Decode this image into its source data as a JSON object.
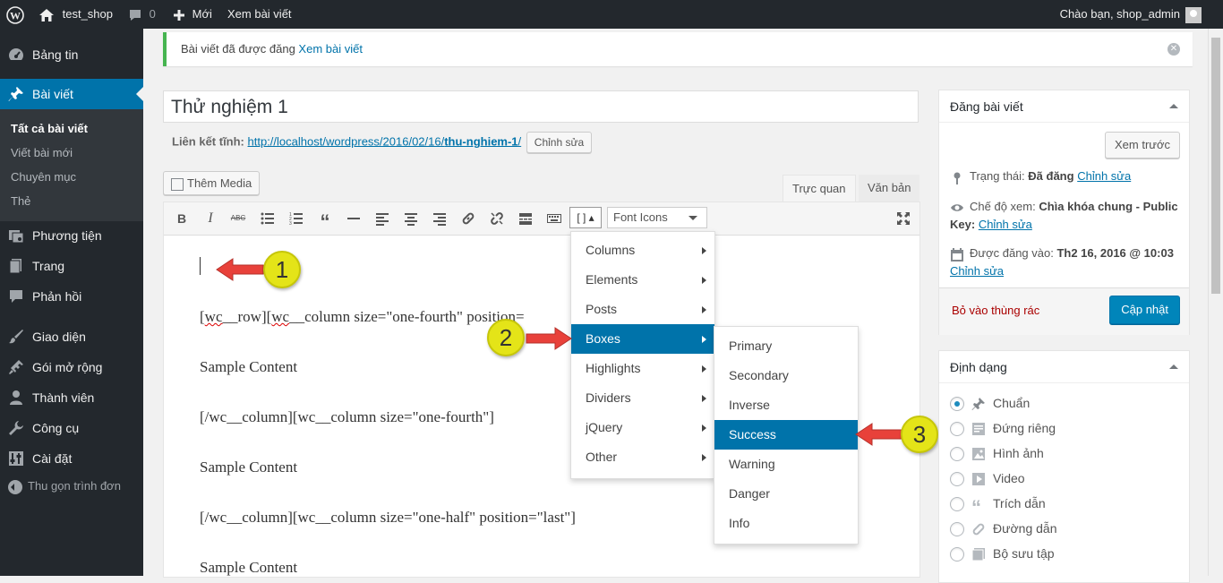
{
  "admin_bar": {
    "site_name": "test_shop",
    "comments_count": "0",
    "new_label": "Mới",
    "view_post_label": "Xem bài viết",
    "greeting": "Chào bạn, shop_admin"
  },
  "sidebar": {
    "items": [
      {
        "label": "Bảng tin",
        "icon": "dashboard-icon"
      },
      {
        "label": "Bài viết",
        "icon": "pin-icon"
      },
      {
        "label": "Phương tiện",
        "icon": "media-icon"
      },
      {
        "label": "Trang",
        "icon": "page-icon"
      },
      {
        "label": "Phản hồi",
        "icon": "comment-icon"
      },
      {
        "label": "Giao diện",
        "icon": "brush-icon"
      },
      {
        "label": "Gói mở rộng",
        "icon": "plugin-icon"
      },
      {
        "label": "Thành viên",
        "icon": "user-icon"
      },
      {
        "label": "Công cụ",
        "icon": "wrench-icon"
      },
      {
        "label": "Cài đặt",
        "icon": "settings-icon"
      }
    ],
    "submenu": [
      "Tất cả bài viết",
      "Viết bài mới",
      "Chuyên mục",
      "Thẻ"
    ],
    "collapse_label": "Thu gọn trình đơn"
  },
  "notice": {
    "text": "Bài viết đã được đăng ",
    "link": "Xem bài viết"
  },
  "editor": {
    "title": "Thử nghiệm 1",
    "permalink_label": "Liên kết tĩnh:",
    "permalink_base": "http://localhost/wordpress/2016/02/16/",
    "permalink_slug": "thu-nghiem-1",
    "permalink_end": "/",
    "edit_slug_label": "Chỉnh sửa",
    "add_media_label": "Thêm Media",
    "tab_visual": "Trực quan",
    "tab_text": "Văn bản",
    "shortcode_button": "[ ]",
    "font_icons_label": "Font Icons",
    "content": {
      "l1_pre": "[",
      "l1_wc1": "wc",
      "l1_mid": "__row][",
      "l1_wc2": "wc",
      "l1_post": "__column size=\"one-fourth\" position=",
      "l2": "Sample Content",
      "l3": "[/wc__column][wc__column size=\"one-fourth\"]",
      "l4": "Sample Content",
      "l5": "[/wc__column][wc__column size=\"one-half\" position=\"last\"]",
      "l6": "Sample Content"
    }
  },
  "shortcode_menu": {
    "items": [
      "Columns",
      "Elements",
      "Posts",
      "Boxes",
      "Highlights",
      "Dividers",
      "jQuery",
      "Other"
    ],
    "active": "Boxes"
  },
  "boxes_menu": {
    "items": [
      "Primary",
      "Secondary",
      "Inverse",
      "Success",
      "Warning",
      "Danger",
      "Info"
    ],
    "active": "Success"
  },
  "callouts": [
    "1",
    "2",
    "3"
  ],
  "publish_box": {
    "title": "Đăng bài viết",
    "preview_label": "Xem trước",
    "status_label": "Trạng thái: ",
    "status_value": "Đã đăng",
    "visibility_label": "Chế độ xem: ",
    "visibility_value": "Chìa khóa chung - Public Key:",
    "published_label": "Được đăng vào: ",
    "published_value": "Th2 16, 2016 @ 10:03",
    "edit_label": "Chỉnh sửa",
    "trash_label": "Bỏ vào thùng rác",
    "update_label": "Cập nhật"
  },
  "format_box": {
    "title": "Định dạng",
    "options": [
      {
        "label": "Chuẩn",
        "icon": "pin-icon",
        "checked": true
      },
      {
        "label": "Đứng riêng",
        "icon": "aside-icon",
        "checked": false
      },
      {
        "label": "Hình ảnh",
        "icon": "image-icon",
        "checked": false
      },
      {
        "label": "Video",
        "icon": "video-icon",
        "checked": false
      },
      {
        "label": "Trích dẫn",
        "icon": "quote-icon",
        "checked": false
      },
      {
        "label": "Đường dẫn",
        "icon": "link-icon",
        "checked": false
      },
      {
        "label": "Bộ sưu tập",
        "icon": "gallery-icon",
        "checked": false
      }
    ]
  },
  "colors": {
    "admin_bar": "#23282d",
    "accent": "#0073aa",
    "callout_fill": "#e4e418",
    "callout_arrow": "#e8413a",
    "notice_border": "#46b450"
  }
}
